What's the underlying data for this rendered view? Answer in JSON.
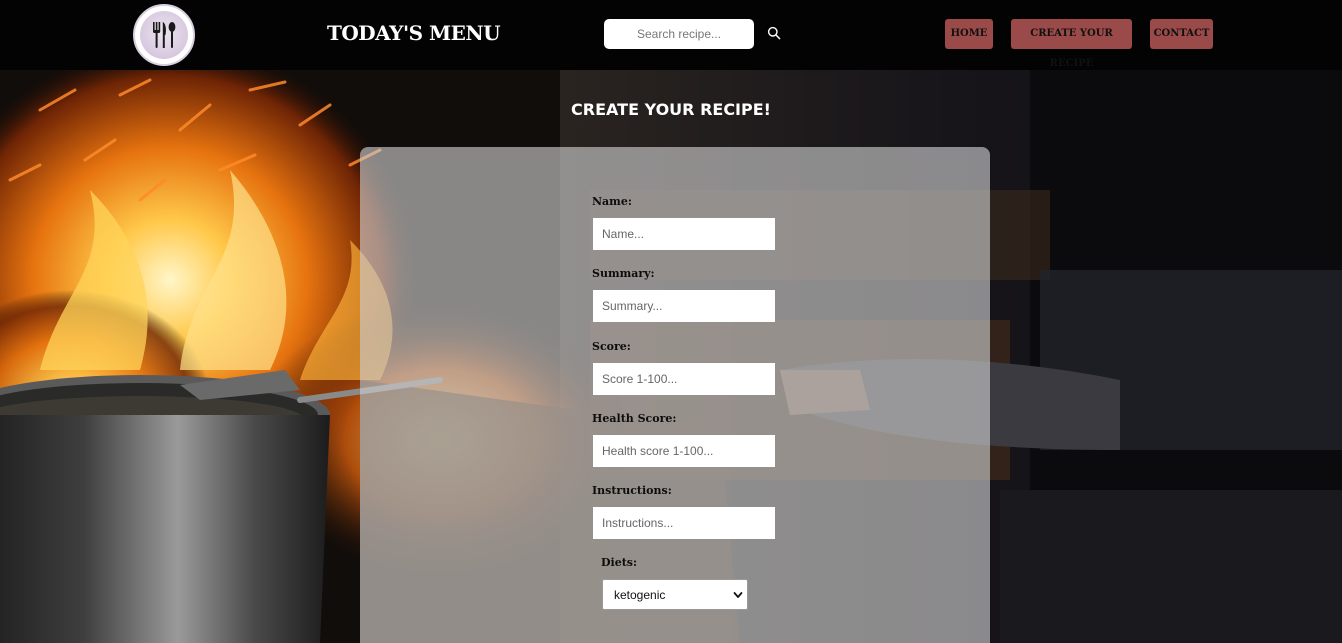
{
  "header": {
    "brand": "TODAY'S MENU",
    "search_placeholder": "Search recipe...",
    "nav": {
      "home": "HOME",
      "create": "CREATE YOUR RECIPE",
      "contact": "CONTACT"
    }
  },
  "page_title": "CREATE YOUR RECIPE!",
  "form": {
    "name": {
      "label": "Name:",
      "placeholder": "Name..."
    },
    "summary": {
      "label": "Summary:",
      "placeholder": "Summary..."
    },
    "score": {
      "label": "Score:",
      "placeholder": "Score 1-100..."
    },
    "health_score": {
      "label": "Health Score:",
      "placeholder": "Health score 1-100..."
    },
    "instructions": {
      "label": "Instructions:",
      "placeholder": "Instructions..."
    },
    "diets": {
      "label": "Diets:",
      "selected": "ketogenic"
    }
  },
  "icons": {
    "logo": "plate-fork-knife-icon",
    "search": "search-icon",
    "dropdown": "chevron-down-icon"
  },
  "colors": {
    "header_bg": "#030303",
    "nav_button": "#9a4a48",
    "card_overlay": "rgba(205,205,205,0.64)"
  }
}
